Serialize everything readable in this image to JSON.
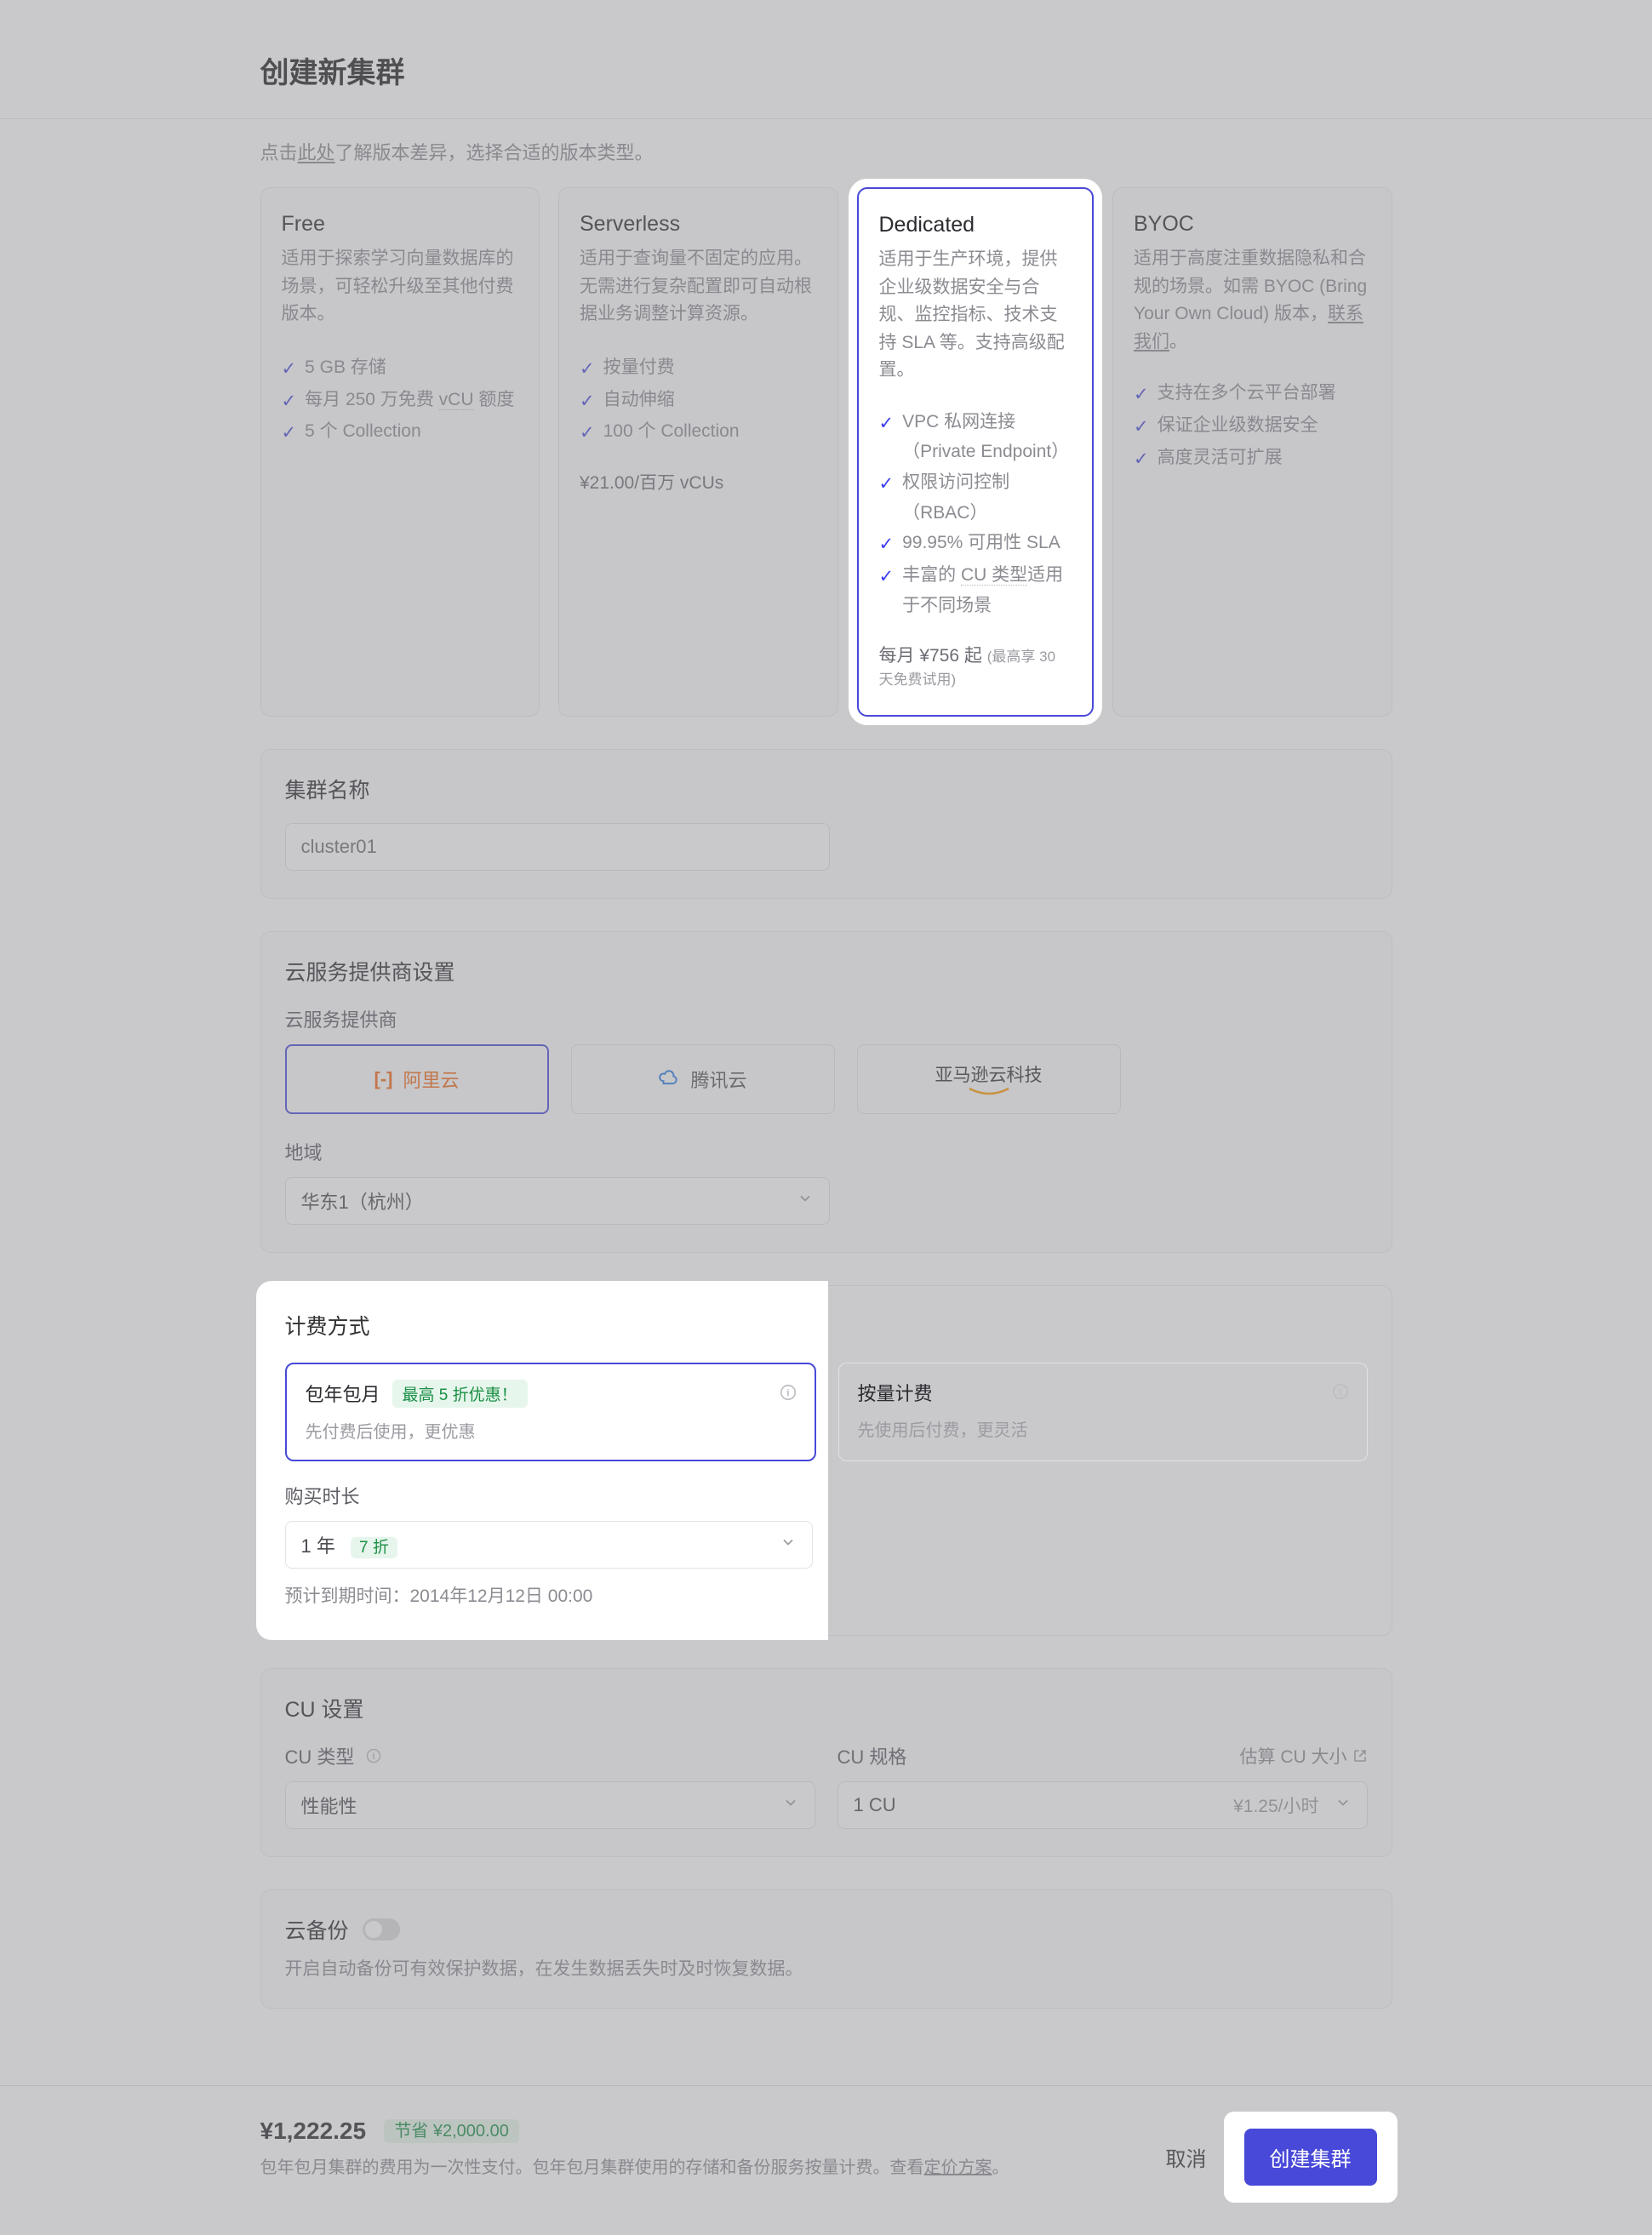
{
  "header": {
    "title": "创建新集群"
  },
  "hint": {
    "prefix": "点击",
    "link": "此处",
    "suffix": "了解版本差异，选择合适的版本类型。"
  },
  "plans": {
    "free": {
      "title": "Free",
      "desc": "适用于探索学习向量数据库的场景，可轻松升级至其他付费版本。",
      "features": [
        "5 GB 存储",
        "每月 250 万免费 vCU 额度",
        "5 个 Collection"
      ],
      "dotted": [
        "vCU"
      ]
    },
    "serverless": {
      "title": "Serverless",
      "desc": "适用于查询量不固定的应用。无需进行复杂配置即可自动根据业务调整计算资源。",
      "features": [
        "按量付费",
        "自动伸缩",
        "100 个 Collection"
      ],
      "price": "¥21.00/百万 vCUs"
    },
    "dedicated": {
      "title": "Dedicated",
      "desc": "适用于生产环境，提供企业级数据安全与合规、监控指标、技术支持 SLA 等。支持高级配置。",
      "features": [
        "VPC 私网连接（Private Endpoint）",
        "权限访问控制（RBAC）",
        "99.95% 可用性 SLA",
        "丰富的 CU 类型适用于不同场景"
      ],
      "dotted2": "CU 类型",
      "price_prefix": "每月 ¥756 起",
      "price_small": "(最高享 30 天免费试用)"
    },
    "byoc": {
      "title": "BYOC",
      "desc_prefix": "适用于高度注重数据隐私和合规的场景。如需 BYOC (Bring Your Own Cloud) 版本，",
      "desc_link": "联系我们",
      "desc_suffix": "。",
      "features": [
        "支持在多个云平台部署",
        "保证企业级数据安全",
        "高度灵活可扩展"
      ]
    }
  },
  "cluster_name": {
    "section_title": "集群名称",
    "value": "cluster01"
  },
  "provider": {
    "section_title": "云服务提供商设置",
    "label": "云服务提供商",
    "options": [
      "阿里云",
      "腾讯云",
      "亚马逊云科技"
    ],
    "region_label": "地域",
    "region_value": "华东1（杭州）"
  },
  "billing": {
    "section_title": "计费方式",
    "prepaid": {
      "title": "包年包月",
      "badge": "最高 5 折优惠！",
      "desc": "先付费后使用，更优惠"
    },
    "postpaid": {
      "title": "按量计费",
      "desc": "先使用后付费，更灵活"
    },
    "duration_label": "购买时长",
    "duration_value": "1 年",
    "duration_tag": "7 折",
    "expire_label": "预计到期时间：",
    "expire_value": "2014年12月12日 00:00"
  },
  "cu": {
    "section_title": "CU 设置",
    "type_label": "CU 类型",
    "type_value": "性能性",
    "spec_label": "CU 规格",
    "spec_value": "1 CU",
    "spec_price": "¥1.25/小时",
    "estimate_link": "估算 CU 大小"
  },
  "backup": {
    "title": "云备份",
    "desc": "开启自动备份可有效保护数据，在发生数据丢失时及时恢复数据。"
  },
  "bottom": {
    "price": "¥1,222.25",
    "save": "节省 ¥2,000.00",
    "desc_prefix": "包年包月集群的费用为一次性支付。包年包月集群使用的存储和备份服务按量计费。查看",
    "desc_link": "定价方案",
    "desc_suffix": "。",
    "cancel": "取消",
    "create": "创建集群"
  }
}
